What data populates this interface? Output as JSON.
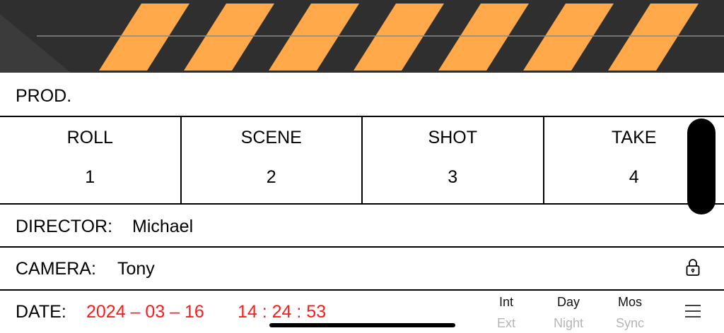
{
  "prod": {
    "label": "PROD.",
    "value": ""
  },
  "slate": [
    {
      "label": "ROLL",
      "value": "1"
    },
    {
      "label": "SCENE",
      "value": "2"
    },
    {
      "label": "SHOT",
      "value": "3"
    },
    {
      "label": "TAKE",
      "value": "4"
    }
  ],
  "director": {
    "label": "DIRECTOR:",
    "value": "Michael"
  },
  "camera": {
    "label": "CAMERA:",
    "value": "Tony",
    "lock_icon": "lock-icon"
  },
  "date": {
    "label": "DATE:",
    "date_value": "2024 – 03 – 16",
    "time_value": "14 : 24 : 53",
    "color": "#ff1a1a"
  },
  "toggles": [
    {
      "on": "Int",
      "off": "Ext"
    },
    {
      "on": "Day",
      "off": "Night"
    },
    {
      "on": "Mos",
      "off": "Sync"
    }
  ],
  "menu_icon": "hamburger-menu-icon",
  "colors": {
    "stripe": "#ffa94a",
    "clapper": "#2f2f2f"
  }
}
